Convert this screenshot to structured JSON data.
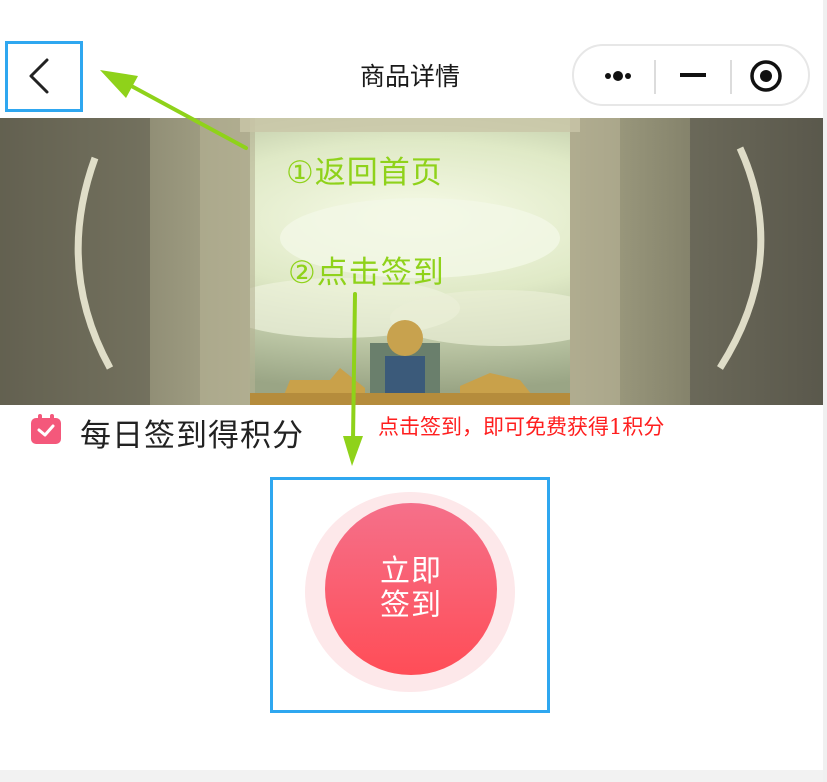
{
  "nav": {
    "title": "商品详情",
    "back_icon": "chevron-left-icon",
    "capsule": {
      "more_icon": "more-dots-icon",
      "minimize_icon": "minimize-icon",
      "close_icon": "record-circle-icon"
    }
  },
  "banner": {
    "scene": "game-artwork-banner"
  },
  "checkin": {
    "title": "每日签到得积分",
    "hint": "点击签到，即可免费获得1积分",
    "icon": "calendar-icon",
    "button_line1": "立即",
    "button_line2": "签到"
  },
  "annotations": {
    "step1": "①返回首页",
    "step2": "②点击签到"
  },
  "colors": {
    "annotation_green": "#8fd21a",
    "highlight_blue": "#2fa7f0",
    "hint_red": "#ff1f1f",
    "button_gradient_top": "#f5708a",
    "button_gradient_bottom": "#ff4d57",
    "calendar_pink": "#f4587b"
  }
}
